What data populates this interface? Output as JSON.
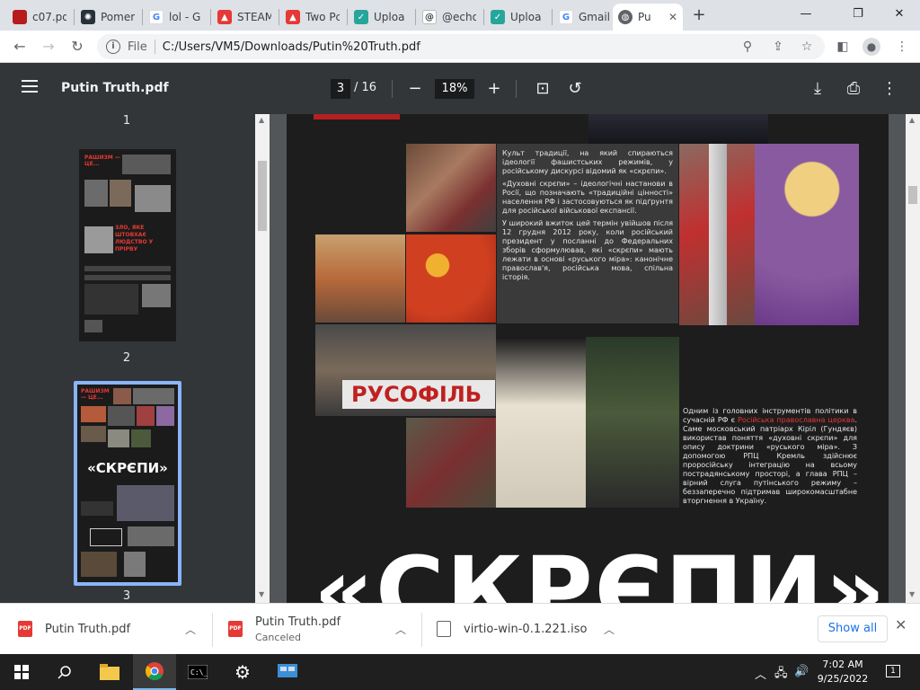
{
  "browser": {
    "tabs": [
      {
        "label": "c07.pd",
        "color": "#b71c1c",
        "icon": "c07-favicon"
      },
      {
        "label": "Pomer",
        "color": "#263238",
        "icon": "pomer-favicon"
      },
      {
        "label": "lol - G",
        "color": "#4285f4",
        "icon": "google-favicon"
      },
      {
        "label": "STEAM",
        "color": "#e53935",
        "icon": "pdf-favicon"
      },
      {
        "label": "Two Pc",
        "color": "#e53935",
        "icon": "pdf-favicon"
      },
      {
        "label": "Uploa",
        "color": "#26a69a",
        "icon": "upload-favicon"
      },
      {
        "label": "@echo",
        "color": "#3c4043",
        "icon": "at-favicon"
      },
      {
        "label": "Uploa",
        "color": "#26a69a",
        "icon": "upload-favicon"
      },
      {
        "label": "Gmail",
        "color": "#4285f4",
        "icon": "google-favicon"
      },
      {
        "label": "Pu",
        "color": "#5f6368",
        "icon": "globe-favicon"
      }
    ],
    "new_tab": "+",
    "address": {
      "scheme_label": "File",
      "url": "C:/Users/VM5/Downloads/Putin%20Truth.pdf"
    }
  },
  "pdf": {
    "title": "Putin Truth.pdf",
    "current_page": "3",
    "total_pages": "/ 16",
    "zoom": "18%"
  },
  "thumbnails": [
    {
      "number": "1"
    },
    {
      "number": "2",
      "title_text": "РАШИЗМ — ЦЕ...",
      "headline": "ЗЛО, ЯКЕ ШТОВХАЄ ЛЮДСТВО У ПРІРВУ"
    },
    {
      "number": "3",
      "title_text": "РАШИЗМ — ЦЕ...",
      "headline": "«СКРЄПИ»"
    }
  ],
  "page_content": {
    "text_box": [
      "Культ традиції, на який спираються ідеології фашистських режимів, у російському дискурсі відомий як «скрєпи».",
      "«Духовні скрєпи» – ідеологічні настанови в Росії, що позначають «традиційні цінності» населення РФ і застосовуються як підґрунтя для російської військової експансії.",
      "У широкий вжиток цей термін увійшов після 12 грудня 2012 року, коли російський президент у посланні до Федеральних зборів сформулював, які «скрєпи» мають лежати в основі «руського міра»: канонічне православ'я, російська мова, спільна історія."
    ],
    "side_text_before": "Одним із головних інструментів політики в сучасній РФ є ",
    "side_text_red": "Російська православна церква",
    "side_text_after": ". Саме московський патріарх Кіріл (Гундяєв) використав поняття «духовні скрєпи» для опису доктрини «руського міра». З допомогою РПЦ Кремль здійснює проросійську інтеграцію на всьому пострадянському просторі, а глава РПЦ – вірний слуга путінського режиму – беззаперечно підтримав широкомасштабне вторгнення в Україну.",
    "banner_text": "РУСОФІЛЬ",
    "big_title": "«СКРЄПИ»"
  },
  "downloads": {
    "items": [
      {
        "name": "Putin Truth.pdf",
        "status": ""
      },
      {
        "name": "Putin Truth.pdf",
        "status": "Canceled"
      },
      {
        "name": "virtio-win-0.1.221.iso",
        "status": ""
      }
    ],
    "show_all": "Show all"
  },
  "taskbar": {
    "time": "7:02 AM",
    "date": "9/25/2022"
  }
}
